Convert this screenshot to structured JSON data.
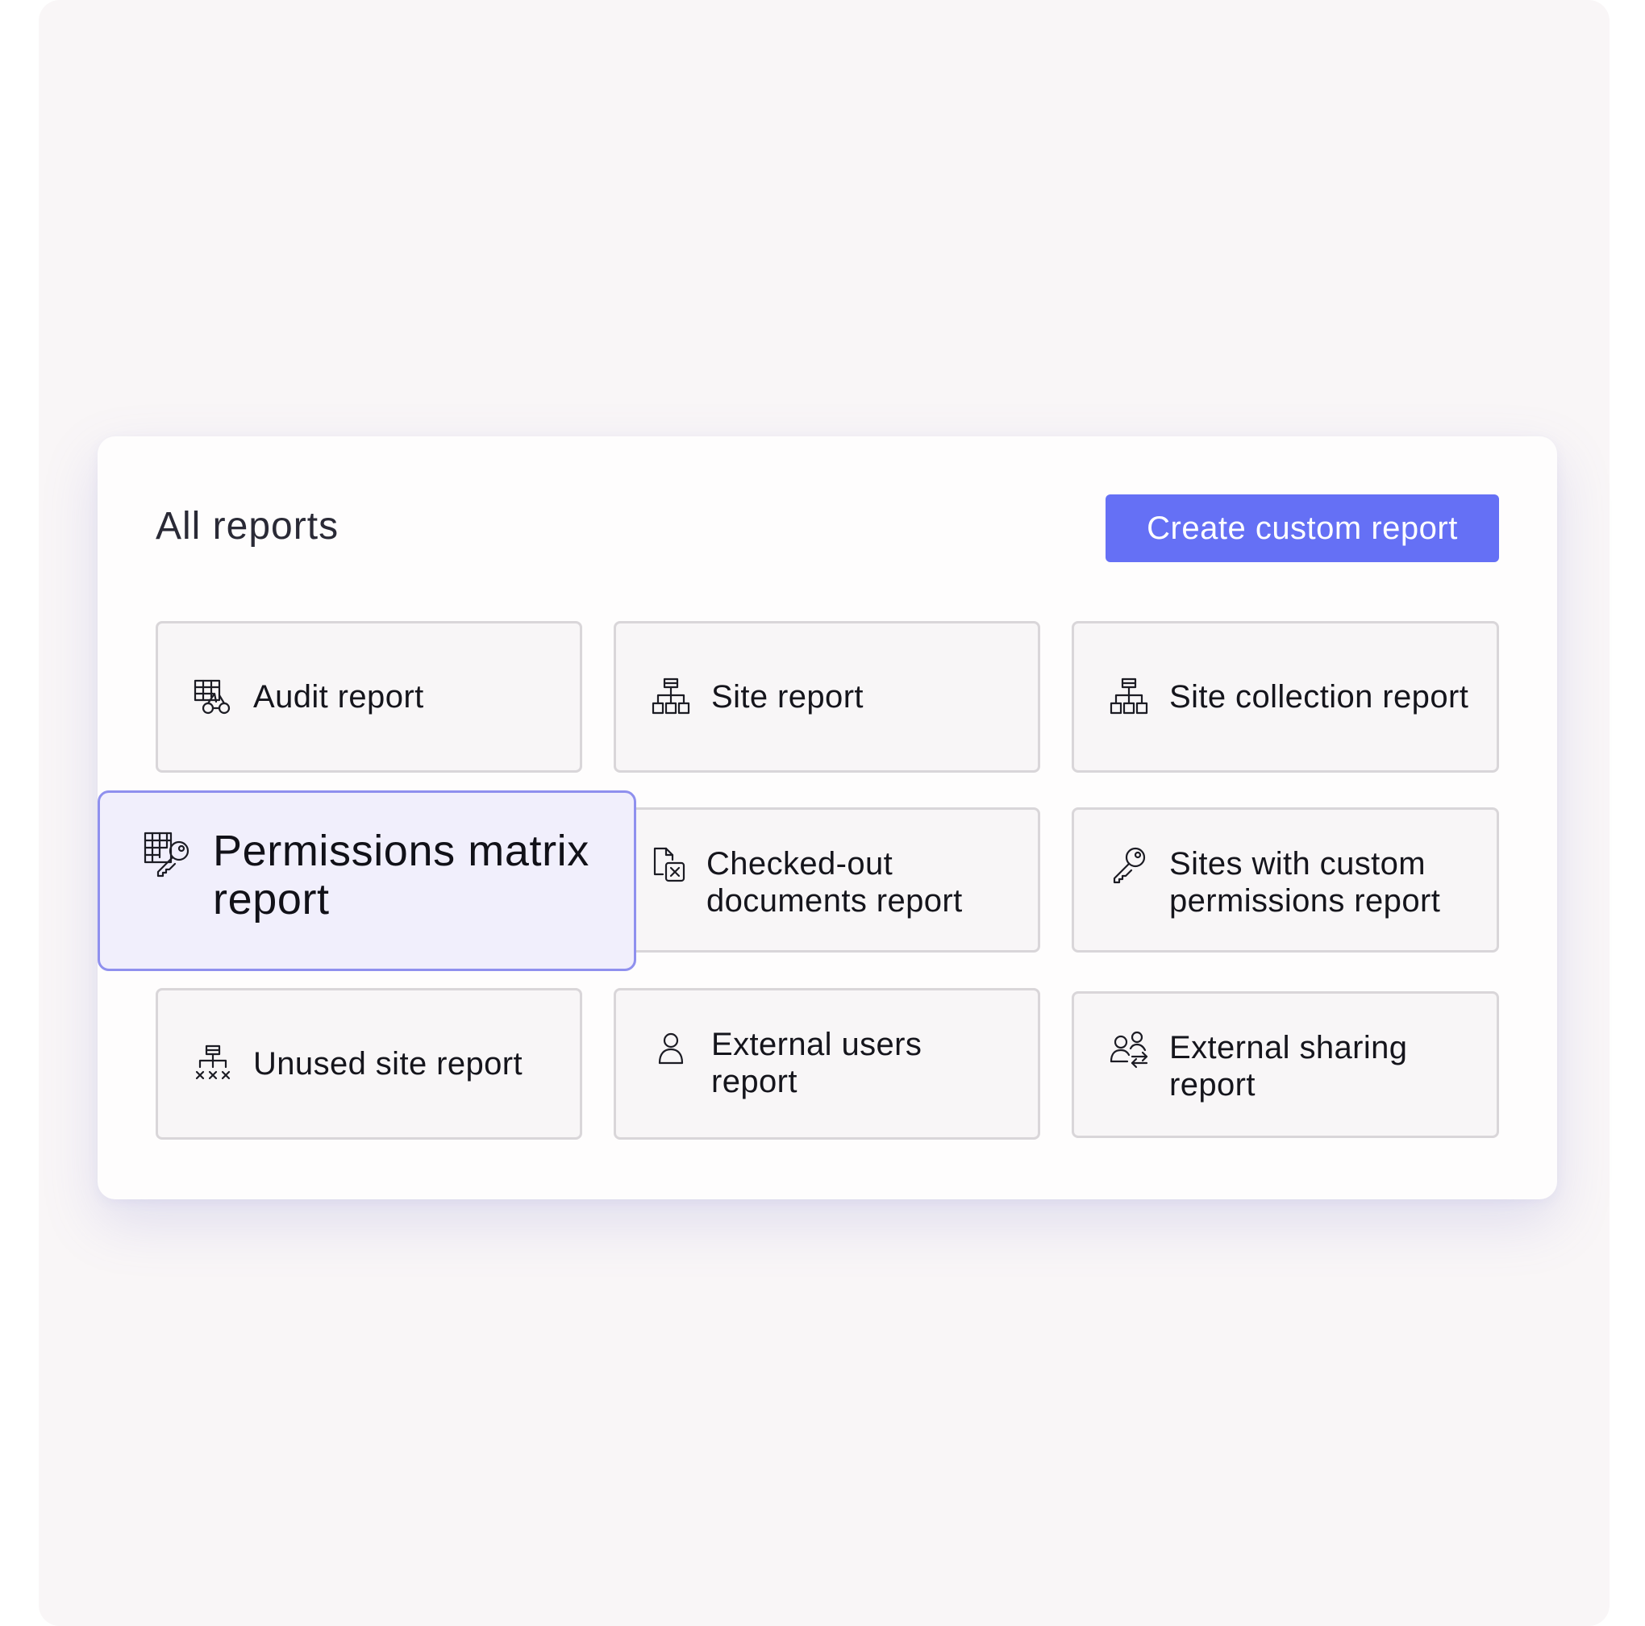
{
  "page": {
    "title": "All reports",
    "create_button": "Create custom report"
  },
  "reports": [
    {
      "id": "audit",
      "label": "Audit report",
      "icon": "audit-icon"
    },
    {
      "id": "site",
      "label": "Site report",
      "icon": "sitemap-icon"
    },
    {
      "id": "site-collection",
      "label": "Site collection report",
      "icon": "sitemap-icon"
    },
    {
      "id": "permissions-matrix",
      "label": "Permissions matrix report",
      "icon": "grid-key-icon",
      "highlighted": true
    },
    {
      "id": "checked-out",
      "label": "Checked-out documents report",
      "icon": "document-x-icon"
    },
    {
      "id": "sites-custom-permissions",
      "label": "Sites with custom permissions report",
      "icon": "key-icon"
    },
    {
      "id": "unused-site",
      "label": "Unused site report",
      "icon": "sitemap-x-icon"
    },
    {
      "id": "external-users",
      "label": "External users report",
      "icon": "user-icon"
    },
    {
      "id": "external-sharing",
      "label": "External sharing report",
      "icon": "users-share-icon"
    }
  ],
  "colors": {
    "accent": "#6570f5",
    "highlight_bg": "#f1effc",
    "highlight_border": "#8f90ee",
    "tile_border": "#d9d6d9"
  }
}
